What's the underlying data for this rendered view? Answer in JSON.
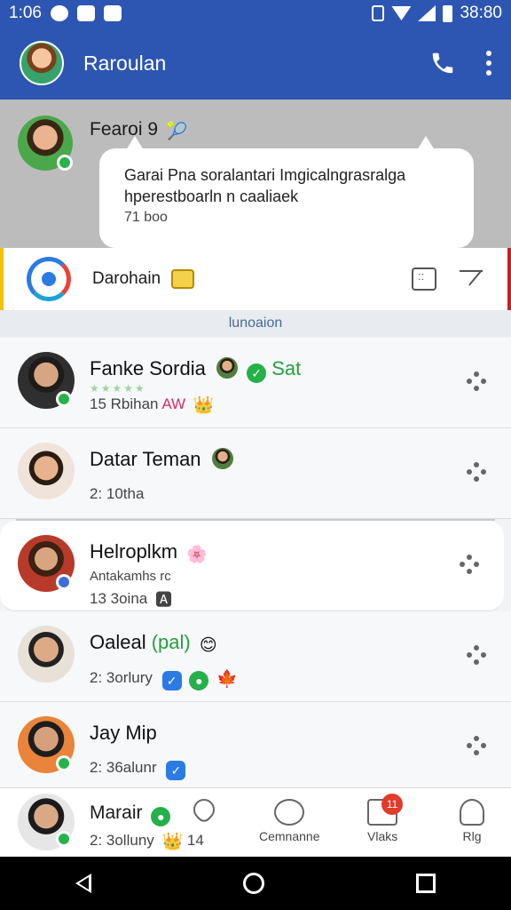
{
  "status_bar": {
    "time": "1:06",
    "clock_right": "38:80"
  },
  "app_bar": {
    "title": "Raroulan"
  },
  "notification": {
    "sender": "Fearoi 9",
    "sender_emoji": "🎾",
    "message_line1": "Garai Pna soralantari Imgicalngrasralga",
    "message_line2": "hperestboarln n caaliaek",
    "time": "71 boo"
  },
  "channel": {
    "name": "Darohain"
  },
  "section": {
    "label": "lunoaion"
  },
  "contacts": [
    {
      "name": "Fanke Sordia",
      "tag": "Sat",
      "sub": "15 Rbihan",
      "sub_highlight": "AW",
      "emoji": "👑"
    },
    {
      "name": "Datar Teman",
      "sub": "2: 10tha"
    },
    {
      "name": "Helroplkm",
      "emoji": "🌸",
      "sub1": "Antakamhs rc",
      "sub2": "13 3oina",
      "tag_emoji": "🅰"
    },
    {
      "name": "Oaleal",
      "tag": "(pal)",
      "emoji": "😊",
      "sub": "2: 3orlury",
      "leaf": "🍁"
    },
    {
      "name": "Jay Mip",
      "sub": "2: 36alunr"
    }
  ],
  "me": {
    "name": "Marair",
    "sub": "2: 3olluny",
    "crown": "👑",
    "count": "14"
  },
  "tabs": [
    {
      "label": "",
      "id": "favorites"
    },
    {
      "label": "Cemnanne",
      "id": "chats"
    },
    {
      "label": "Vlaks",
      "id": "messages",
      "badge": "11"
    },
    {
      "label": "Rlg",
      "id": "profile"
    }
  ]
}
